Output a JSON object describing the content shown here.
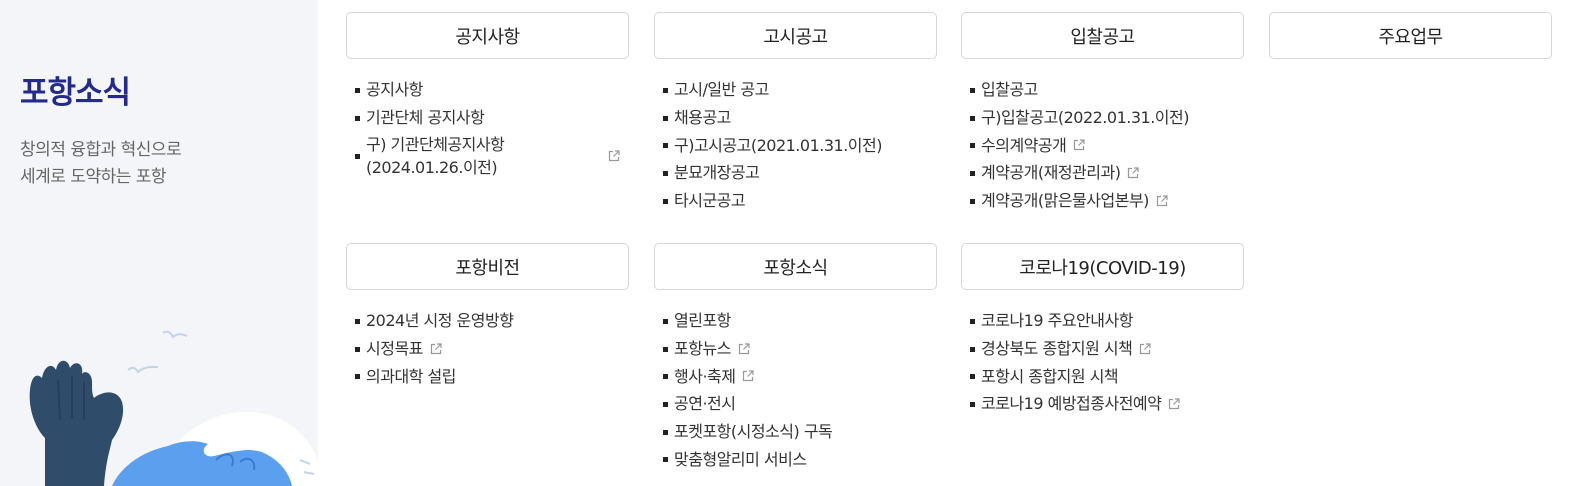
{
  "sidebar": {
    "title": "포항소식",
    "desc_line1": "창의적 융합과 혁신으로",
    "desc_line2": "세계로 도약하는 포항"
  },
  "colors": {
    "title": "#232a8c",
    "sidebar_bg": "#f4f5f8",
    "hand": "#2f4d6a",
    "wave": "#5aa0ee"
  },
  "sections": [
    {
      "title": "공지사항",
      "items": [
        {
          "label": "공지사항",
          "external": false
        },
        {
          "label": "기관단체 공지사항",
          "external": false
        },
        {
          "label_line1": "구) 기관단체공지사항",
          "label_line2": "(2024.01.26.이전)",
          "external": true
        }
      ]
    },
    {
      "title": "고시공고",
      "items": [
        {
          "label": "고시/일반 공고",
          "external": false
        },
        {
          "label": "채용공고",
          "external": false
        },
        {
          "label": "구)고시공고(2021.01.31.이전)",
          "external": false
        },
        {
          "label": "분묘개장공고",
          "external": false
        },
        {
          "label": "타시군공고",
          "external": false
        }
      ]
    },
    {
      "title": "입찰공고",
      "items": [
        {
          "label": "입찰공고",
          "external": false
        },
        {
          "label": "구)입찰공고(2022.01.31.이전)",
          "external": false
        },
        {
          "label": "수의계약공개",
          "external": true
        },
        {
          "label": "계약공개(재정관리과)",
          "external": true
        },
        {
          "label": "계약공개(맑은물사업본부)",
          "external": true
        }
      ]
    },
    {
      "title": "주요업무",
      "items": []
    },
    {
      "title": "포항비전",
      "items": [
        {
          "label": "2024년 시정 운영방향",
          "external": false
        },
        {
          "label": "시정목표",
          "external": true
        },
        {
          "label": "의과대학 설립",
          "external": false
        }
      ]
    },
    {
      "title": "포항소식",
      "items": [
        {
          "label": "열린포항",
          "external": false
        },
        {
          "label": "포항뉴스",
          "external": true
        },
        {
          "label": "행사·축제",
          "external": true
        },
        {
          "label": "공연·전시",
          "external": false
        },
        {
          "label": "포켓포항(시정소식) 구독",
          "external": false
        },
        {
          "label": "맞춤형알리미 서비스",
          "external": false
        }
      ]
    },
    {
      "title": "코로나19(COVID-19)",
      "items": [
        {
          "label": "코로나19 주요안내사항",
          "external": false
        },
        {
          "label": "경상북도 종합지원 시책",
          "external": true
        },
        {
          "label": "포항시 종합지원 시책",
          "external": false
        },
        {
          "label": "코로나19 예방접종사전예약",
          "external": true
        }
      ]
    }
  ]
}
